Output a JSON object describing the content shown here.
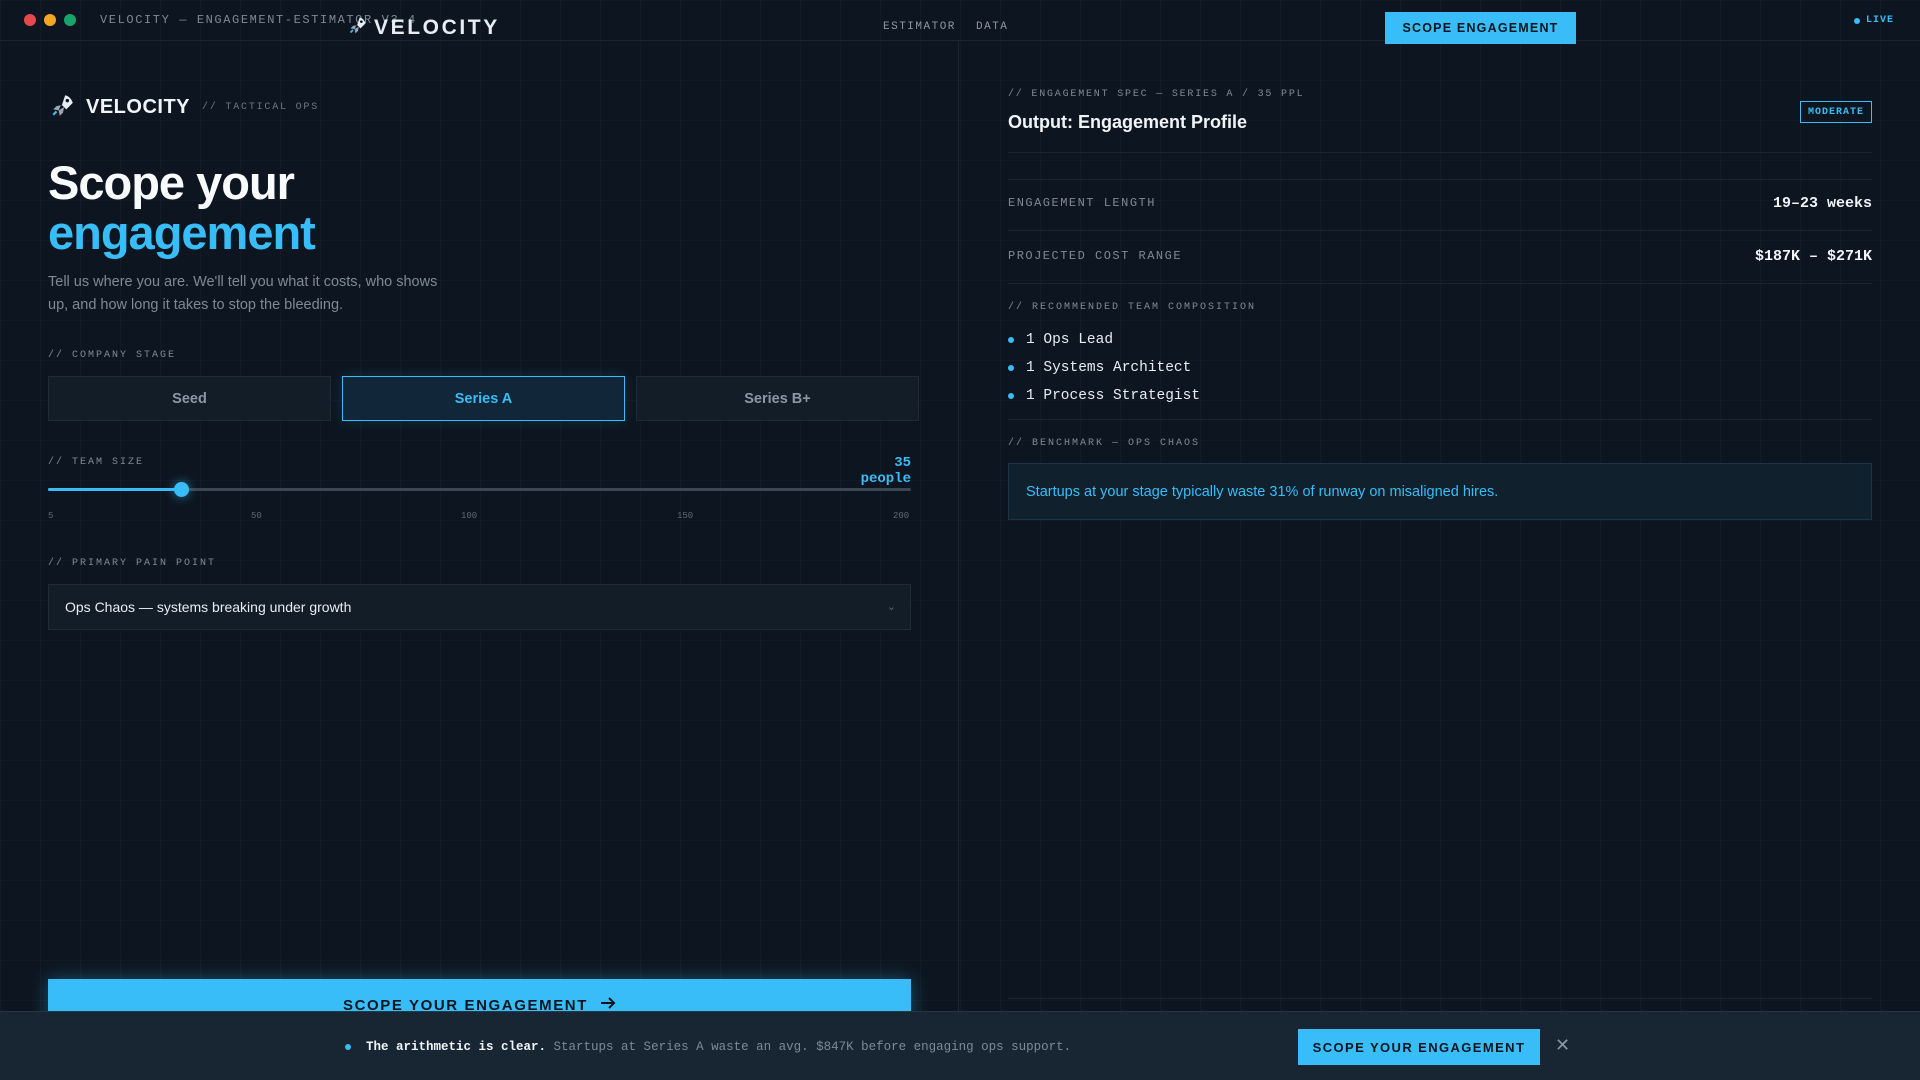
{
  "window": {
    "title": "VELOCITY — ENGAGEMENT-ESTIMATOR V3.4",
    "dot_colors": [
      "#e5484d",
      "#f5a524",
      "#17a36b"
    ]
  },
  "topnav": {
    "brand": "VELOCITY",
    "links": [
      "ESTIMATOR",
      "DATA"
    ],
    "cta": "SCOPE ENGAGEMENT",
    "status": "LIVE"
  },
  "left": {
    "brand": "VELOCITY",
    "brand_sub": "// TACTICAL OPS",
    "headline_1": "Scope your",
    "headline_2": "engagement",
    "lede": "Tell us where you are. We'll tell you what it costs, who shows up, and how long it takes to stop the bleeding.",
    "stage_label": "// COMPANY STAGE",
    "stages": [
      "Seed",
      "Series A",
      "Series B+"
    ],
    "active_stage": "Series A",
    "team_label": "// TEAM SIZE",
    "team_value_text": "35 people",
    "team_value": 35,
    "team_min": 5,
    "team_max": 200,
    "ticks": [
      "5",
      "50",
      "100",
      "150",
      "200"
    ],
    "pain_label": "// PRIMARY PAIN POINT",
    "pain_value": "Ops Chaos — systems breaking under growth",
    "cta": "SCOPE YOUR ENGAGEMENT"
  },
  "right": {
    "eyebrow": "// ENGAGEMENT SPEC — SERIES A / 35 PPL",
    "title": "Output: Engagement Profile",
    "badge": "MODERATE",
    "length_label": "ENGAGEMENT LENGTH",
    "length_value": "19–23 weeks",
    "cost_label": "PROJECTED COST RANGE",
    "cost_value": "$187K – $271K",
    "team_label": "// RECOMMENDED TEAM COMPOSITION",
    "team": [
      "1 Ops Lead",
      "1 Systems Architect",
      "1 Process Strategist"
    ],
    "bench_label": "// BENCHMARK — OPS CHAOS",
    "bench_text": "Startups at your stage typically waste 31% of runway on misaligned hires."
  },
  "banner": {
    "bold": "The arithmetic is clear.",
    "text": "Startups at Series A waste an avg. $847K before engaging ops support.",
    "cta": "SCOPE YOUR ENGAGEMENT"
  },
  "colors": {
    "accent": "#38bdf8",
    "background": "#0d1620"
  }
}
